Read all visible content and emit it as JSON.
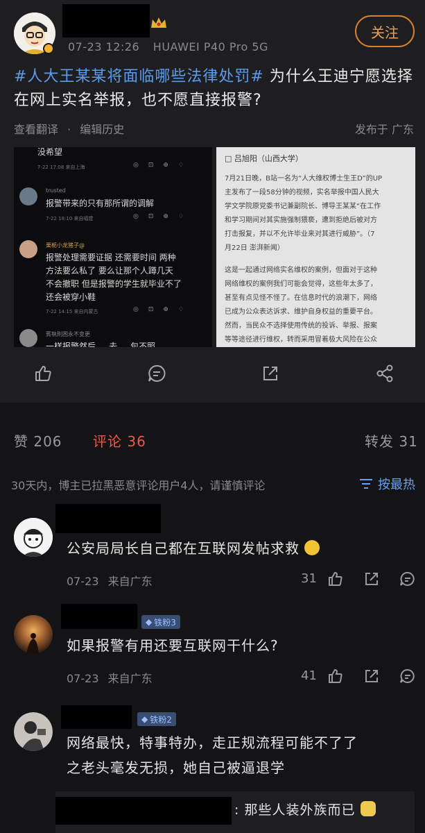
{
  "post": {
    "follow_label": "关注",
    "time": "07-23 12:26",
    "device": "HUAWEI P40 Pro 5G",
    "hashtag": "#人大王某某将面临哪些法律处罚#",
    "text": " 为什么王迪宁愿选择在网上实名举报，也不愿直接报警?",
    "view_translation": "查看翻译",
    "edit_history": "编辑历史",
    "location": "发布于 广东"
  },
  "screenshot_left": {
    "c1_text": "没希望",
    "c1_meta": "7-22 17:08  来自上海",
    "c2_name": "trusted",
    "c2_text": "报警带来的只有那所谓的调解",
    "c2_meta": "7-22 18:10  来自福建",
    "c3_name": "栗栀小龙猪子@",
    "c3_text1": "报警处理需要证据 还需要时间 两种",
    "c3_text2": "方法要么私了 要么让那个人蹲几天",
    "c3_text3": "不会撤职 但是报警的学生就毕业不了",
    "c3_text4": "还会被穿小鞋",
    "c3_meta": "7-22 14:15  来自内蒙古",
    "c4_name": "賓執則困永不变更",
    "c4_text": "一样报警然后 ... 去 ... 包不照"
  },
  "screenshot_right": {
    "author": "□ 吕旭阳（山西大学）",
    "p1_l1": "7月21日晚，B站一名为“人大维权博士生王D”的UP",
    "p1_l2": "主发布了一段58分钟的视频，实名举报中国人民大",
    "p1_l3": "学文学院原党委书记兼副院长、博导王某某“在工作",
    "p1_l4": "和学习期间对其实施强制猥亵，遭到拒绝后被对方",
    "p1_l5": "打击报复，并以不允许毕业来对其进行威胁”。（7",
    "p1_l6": "月22日 澎湃新闻）",
    "p2_l1": "这是一起通过网络实名维权的案例，但面对于这种",
    "p2_l2": "网络维权的案例我们可能会觉得，这些年太多了，",
    "p2_l3": "甚至有点见怪不怪了。在信息时代的浪潮下，网络",
    "p2_l4": "已成为公众表达诉求、维护自身权益的重要平台。",
    "p2_l5": "然而，当民众不选择使用传统的投诉、举报、报案",
    "p2_l6": "等等途径进行维权，转而采用冒着极大风险在公众"
  },
  "stats": {
    "likes": "赞 206",
    "comments": "评论 36",
    "reposts": "转发 31"
  },
  "notice": "30天内，博主已拉黑恶意评论用户4人，请谨慎评论",
  "sort_label": "按最热",
  "comments": [
    {
      "text": "公安局局长自己都在互联网发帖求救",
      "date": "07-23",
      "from": "来自广东",
      "likes": "31"
    },
    {
      "badge": "铁粉3",
      "text": "如果报警有用还要互联网干什么?",
      "date": "07-23",
      "from": "来自广东",
      "likes": "41"
    },
    {
      "badge": "铁粉2",
      "text1": "网络最快，特事特办，走正规流程可能不了了",
      "text2": "之老头毫发无损，她自己被逼退学"
    }
  ],
  "reply_preview": ": 那些人装外族而已",
  "colors": {
    "accent": "#ea5a4a",
    "link": "#5b9bf0",
    "follow": "#d9822b"
  }
}
